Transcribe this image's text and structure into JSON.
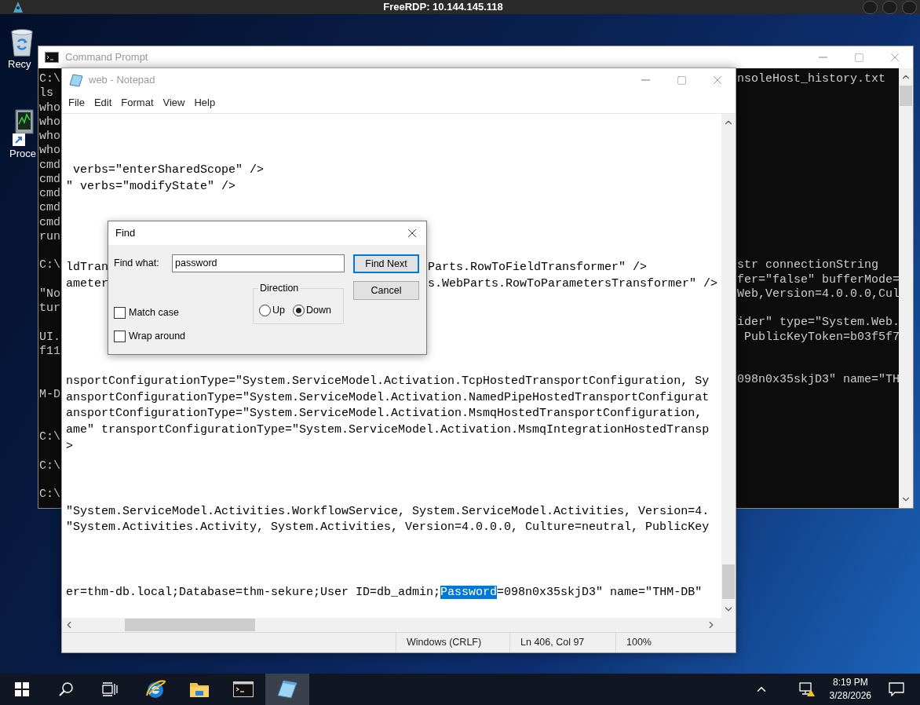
{
  "rdp_bar": {
    "title": "FreeRDP: 10.144.145.118"
  },
  "desktop_icons": [
    {
      "kind": "recycle",
      "label": "Recy"
    },
    {
      "kind": "process",
      "label": "Proce"
    }
  ],
  "command_prompt": {
    "title": "Command Prompt",
    "lines": [
      {
        "kind": "text",
        "left": "C:\\",
        "right": "nsoleHost_history.txt"
      },
      {
        "kind": "text",
        "left": "ls"
      },
      {
        "kind": "text",
        "left": "who"
      },
      {
        "kind": "text",
        "left": "who"
      },
      {
        "kind": "text",
        "left": "who"
      },
      {
        "kind": "text",
        "left": "who"
      },
      {
        "kind": "text",
        "left": "cmd"
      },
      {
        "kind": "text",
        "left": "cmd"
      },
      {
        "kind": "text",
        "left": "cmd"
      },
      {
        "kind": "text",
        "left": "cmd"
      },
      {
        "kind": "text",
        "left": "cmd"
      },
      {
        "kind": "text",
        "left": "run"
      },
      {
        "kind": "blank"
      },
      {
        "kind": "text",
        "left": "C:\\",
        "right": "str connectionString"
      },
      {
        "kind": "text",
        "right": "fer=\"false\" bufferMode="
      },
      {
        "kind": "text",
        "left": "\"No",
        "right": "Web,Version=4.0.0.0,Cul"
      },
      {
        "kind": "text",
        "left": "tur"
      },
      {
        "kind": "text",
        "right": "ider\" type=\"System.Web."
      },
      {
        "kind": "text",
        "left": "UI.",
        "right": " PublicKeyToken=b03f5f7"
      },
      {
        "kind": "text",
        "left": "f11"
      },
      {
        "kind": "blank"
      },
      {
        "kind": "text",
        "right": "098n0x35skjD3\" name=\"TH"
      },
      {
        "kind": "text",
        "left": "M-D"
      },
      {
        "kind": "blank"
      },
      {
        "kind": "blank"
      },
      {
        "kind": "text",
        "left": "C:\\"
      },
      {
        "kind": "blank"
      },
      {
        "kind": "text",
        "left": "C:\\"
      },
      {
        "kind": "blank"
      },
      {
        "kind": "text",
        "left": "C:\\"
      }
    ]
  },
  "notepad": {
    "title": "web - Notepad",
    "menu": [
      "File",
      "Edit",
      "Format",
      "View",
      "Help"
    ],
    "lines": [
      {
        "kind": "blank"
      },
      {
        "kind": "blank"
      },
      {
        "kind": "blank"
      },
      {
        "kind": "plain",
        "text": " verbs=\"enterSharedScope\" />"
      },
      {
        "kind": "plain",
        "text": "\" verbs=\"modifyState\" />"
      },
      {
        "kind": "blank"
      },
      {
        "kind": "blank"
      },
      {
        "kind": "blank"
      },
      {
        "kind": "blank"
      },
      {
        "kind": "split",
        "text": "ldTran",
        "after": "Parts.RowToFieldTransformer\" />"
      },
      {
        "kind": "split",
        "text": "ameter",
        "after": "s.WebParts.RowToParametersTransformer\" />"
      },
      {
        "kind": "blank"
      },
      {
        "kind": "blank"
      },
      {
        "kind": "blank"
      },
      {
        "kind": "blank"
      },
      {
        "kind": "blank"
      },
      {
        "kind": "plain",
        "text": "nsportConfigurationType=\"System.ServiceModel.Activation.TcpHostedTransportConfiguration, Sy"
      },
      {
        "kind": "plain",
        "text": "ansportConfigurationType=\"System.ServiceModel.Activation.NamedPipeHostedTransportConfigurat"
      },
      {
        "kind": "plain",
        "text": "ansportConfigurationType=\"System.ServiceModel.Activation.MsmqHostedTransportConfiguration,"
      },
      {
        "kind": "plain",
        "text": "ame\" transportConfigurationType=\"System.ServiceModel.Activation.MsmqIntegrationHostedTransp"
      },
      {
        "kind": "plain",
        "text": ">"
      },
      {
        "kind": "blank"
      },
      {
        "kind": "blank"
      },
      {
        "kind": "blank"
      },
      {
        "kind": "plain",
        "text": "\"System.ServiceModel.Activities.WorkflowService, System.ServiceModel.Activities, Version=4."
      },
      {
        "kind": "plain",
        "text": "\"System.Activities.Activity, System.Activities, Version=4.0.0.0, Culture=neutral, PublicKey"
      },
      {
        "kind": "blank"
      },
      {
        "kind": "blank"
      },
      {
        "kind": "blank"
      },
      {
        "kind": "search_hit",
        "segments": [
          {
            "text": "er=thm-db.local;Database=thm-sekure;User ID=db_admin;",
            "selected": false
          },
          {
            "text": "Password",
            "selected": true
          },
          {
            "text": "=098n0x35skjD3\" name=\"THM-DB\"",
            "selected": false
          }
        ]
      }
    ],
    "status": [
      "Windows (CRLF)",
      "Ln 406, Col 97",
      "100%"
    ]
  },
  "find_dialog": {
    "title": "Find",
    "find_label": "Find what:",
    "value": "password",
    "find_next": "Find Next",
    "cancel": "Cancel",
    "direction_label": "Direction",
    "directions": [
      {
        "label": "Up",
        "selected": false
      },
      {
        "label": "Down",
        "selected": true
      }
    ],
    "options": [
      {
        "label": "Match case",
        "checked": false
      },
      {
        "label": "Wrap around",
        "checked": false
      }
    ]
  },
  "taskbar": {
    "apps": [
      {
        "kind": "start",
        "active": false
      },
      {
        "kind": "search",
        "active": false
      },
      {
        "kind": "task_view",
        "active": false
      },
      {
        "kind": "browser",
        "active": false
      },
      {
        "kind": "folder",
        "active": false
      },
      {
        "kind": "terminal",
        "active": false
      },
      {
        "kind": "notepad",
        "active": true
      }
    ],
    "time": "8:19 PM",
    "date": "3/28/2026"
  }
}
